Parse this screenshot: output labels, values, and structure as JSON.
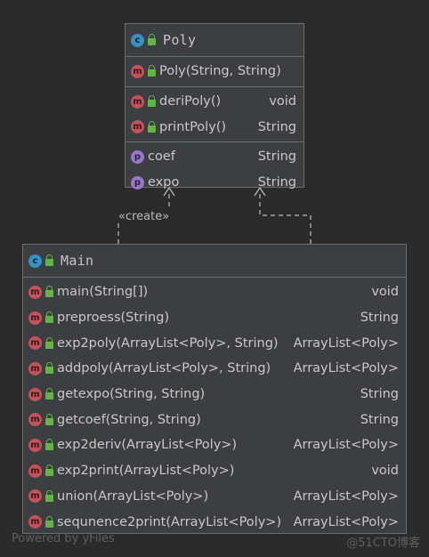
{
  "poly": {
    "name": "Poly",
    "constructor": {
      "name": "Poly(String, String)",
      "type": ""
    },
    "methods": [
      {
        "name": "deriPoly()",
        "type": "void"
      },
      {
        "name": "printPoly()",
        "type": "String"
      }
    ],
    "fields": [
      {
        "name": "coef",
        "type": "String"
      },
      {
        "name": "expo",
        "type": "String"
      }
    ]
  },
  "main": {
    "name": "Main",
    "methods": [
      {
        "name": "main(String[])",
        "type": "void"
      },
      {
        "name": "preproess(String)",
        "type": "String"
      },
      {
        "name": "exp2poly(ArrayList<Poly>, String)",
        "type": "ArrayList<Poly>"
      },
      {
        "name": "addpoly(ArrayList<Poly>, String)",
        "type": "ArrayList<Poly>"
      },
      {
        "name": "getexpo(String, String)",
        "type": "String"
      },
      {
        "name": "getcoef(String, String)",
        "type": "String"
      },
      {
        "name": "exp2deriv(ArrayList<Poly>)",
        "type": "ArrayList<Poly>"
      },
      {
        "name": "exp2print(ArrayList<Poly>)",
        "type": "void"
      },
      {
        "name": "union(ArrayList<Poly>)",
        "type": "ArrayList<Poly>"
      },
      {
        "name": "sequnence2print(ArrayList<Poly>)",
        "type": "ArrayList<Poly>"
      }
    ]
  },
  "edges": {
    "create_label": "«create»"
  },
  "icons": {
    "class": "c",
    "method": "m",
    "field": "p"
  },
  "watermark": {
    "left": "Powered by yFiles",
    "right": "@51CTO博客"
  }
}
